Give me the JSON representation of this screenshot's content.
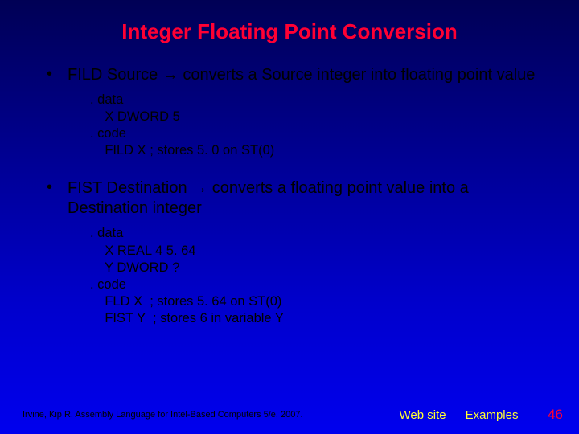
{
  "title": "Integer Floating Point Conversion",
  "bullet1": "FILD Source → converts a Source integer into floating point value",
  "code1_l1": ". data",
  "code1_l2": "    X DWORD 5",
  "code1_l3": ". code",
  "code1_l4": "    FILD X ; stores 5. 0 on ST(0)",
  "bullet2": "FIST Destination → converts a floating point value into a Destination integer",
  "code2_l1": ". data",
  "code2_l2": "    X REAL 4 5. 64",
  "code2_l3": "    Y DWORD ?",
  "code2_l4": ". code",
  "code2_l5": "    FLD X  ; stores 5. 64 on ST(0)",
  "code2_l6": "    FIST Y  ; stores 6 in variable Y",
  "footer": {
    "citation": "Irvine, Kip R. Assembly Language for Intel-Based Computers 5/e, 2007.",
    "link1": "Web site",
    "link2": "Examples",
    "page": "46"
  }
}
